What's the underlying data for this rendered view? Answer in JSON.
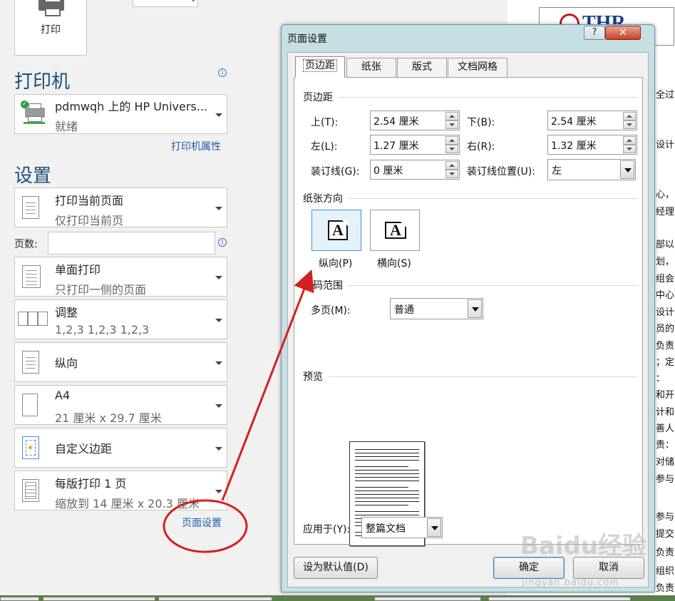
{
  "print_button": {
    "label": "打印"
  },
  "printer": {
    "heading": "打印机",
    "info_glyph": "i",
    "name": "pdmwqh 上的 HP Univers...",
    "status": "就绪",
    "properties_link": "打印机属性"
  },
  "settings": {
    "heading": "设置",
    "pages_label": "页数:",
    "pages_value": "",
    "items": [
      {
        "line1": "打印当前页面",
        "line2": "仅打印当前页"
      },
      {
        "line1": "单面打印",
        "line2": "只打印一侧的页面"
      },
      {
        "line1": "调整",
        "line2": "1,2,3    1,2,3    1,2,3"
      },
      {
        "line1": "纵向",
        "line2": ""
      },
      {
        "line1": "A4",
        "line2": "21 厘米 x 29.7 厘米"
      },
      {
        "line1": "自定义边距",
        "line2": ""
      },
      {
        "line1": "每版打印 1 页",
        "line2": "缩放到 14 厘米 x 20.3 厘米"
      }
    ],
    "page_setup_link": "页面设置"
  },
  "document": {
    "logo_text": "THR",
    "lines": [
      "全过",
      "设计",
      "心，",
      "经理",
      "部以",
      "划，",
      "组会",
      "中心",
      "设计",
      "员的",
      "负责",
      "；定",
      "：",
      "和开",
      "计和",
      "善人",
      "责：",
      "对储",
      "参与",
      "参与",
      "提交",
      "负责",
      "组织",
      "负责"
    ]
  },
  "dialog": {
    "title": "页面设置",
    "help_glyph": "?",
    "close_glyph": "✕",
    "tabs": [
      "页边距",
      "纸张",
      "版式",
      "文档网格"
    ],
    "margins_group": "页边距",
    "fields": {
      "top_label": "上(T):",
      "top_value": "2.54 厘米",
      "bottom_label": "下(B):",
      "bottom_value": "2.54 厘米",
      "left_label": "左(L):",
      "left_value": "1.27 厘米",
      "right_label": "右(R):",
      "right_value": "1.32 厘米",
      "gutter_label": "装订线(G):",
      "gutter_value": "0 厘米",
      "gutter_pos_label": "装订线位置(U):",
      "gutter_pos_value": "左"
    },
    "orientation_group": "纸张方向",
    "orientation_glyph": "A",
    "portrait_label": "纵向(P)",
    "landscape_label": "横向(S)",
    "pages_group": "页码范围",
    "multiple_pages_label": "多页(M):",
    "multiple_pages_value": "普通",
    "preview_group": "预览",
    "apply_to_label": "应用于(Y):",
    "apply_to_value": "整篇文档",
    "set_default_button": "设为默认值(D)",
    "ok_button": "确定",
    "cancel_button": "取消"
  },
  "watermark": {
    "text": "Baidu经验",
    "subtext": "jingyan.baidu.com"
  },
  "colors": {
    "annotation": "#d42020",
    "heading": "#1f4e79",
    "link": "#1f5ea8"
  }
}
